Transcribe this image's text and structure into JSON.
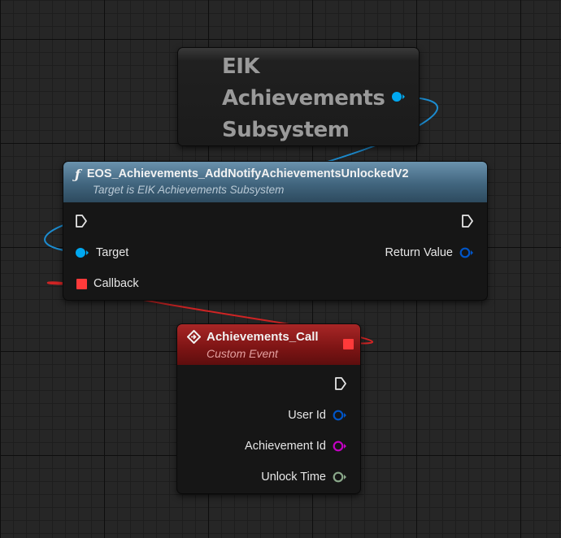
{
  "getter": {
    "title": "EIK Achievements Subsystem"
  },
  "function_node": {
    "icon": "function-icon",
    "title": "EOS_Achievements_AddNotifyAchievementsUnlockedV2",
    "subtitle": "Target is EIK Achievements Subsystem",
    "header_color": "#41657e",
    "pins": {
      "target": "Target",
      "callback": "Callback",
      "return_value": "Return Value"
    }
  },
  "event_node": {
    "icon": "custom-event-icon",
    "title": "Achievements_Call",
    "subtitle": "Custom Event",
    "header_color": "#7c1414",
    "pins": {
      "user_id": "User Id",
      "achievement_id": "Achievement Id",
      "unlock_time": "Unlock Time"
    }
  },
  "colors": {
    "object_pin": "#00a8f0",
    "struct_pin": "#0055c8",
    "delegate_pin": "#ff3a3a",
    "name_pin": "#c400c4",
    "datetime_pin": "#8aa88a",
    "object_wire": "#1c8cd0",
    "delegate_wire": "#d02424"
  }
}
